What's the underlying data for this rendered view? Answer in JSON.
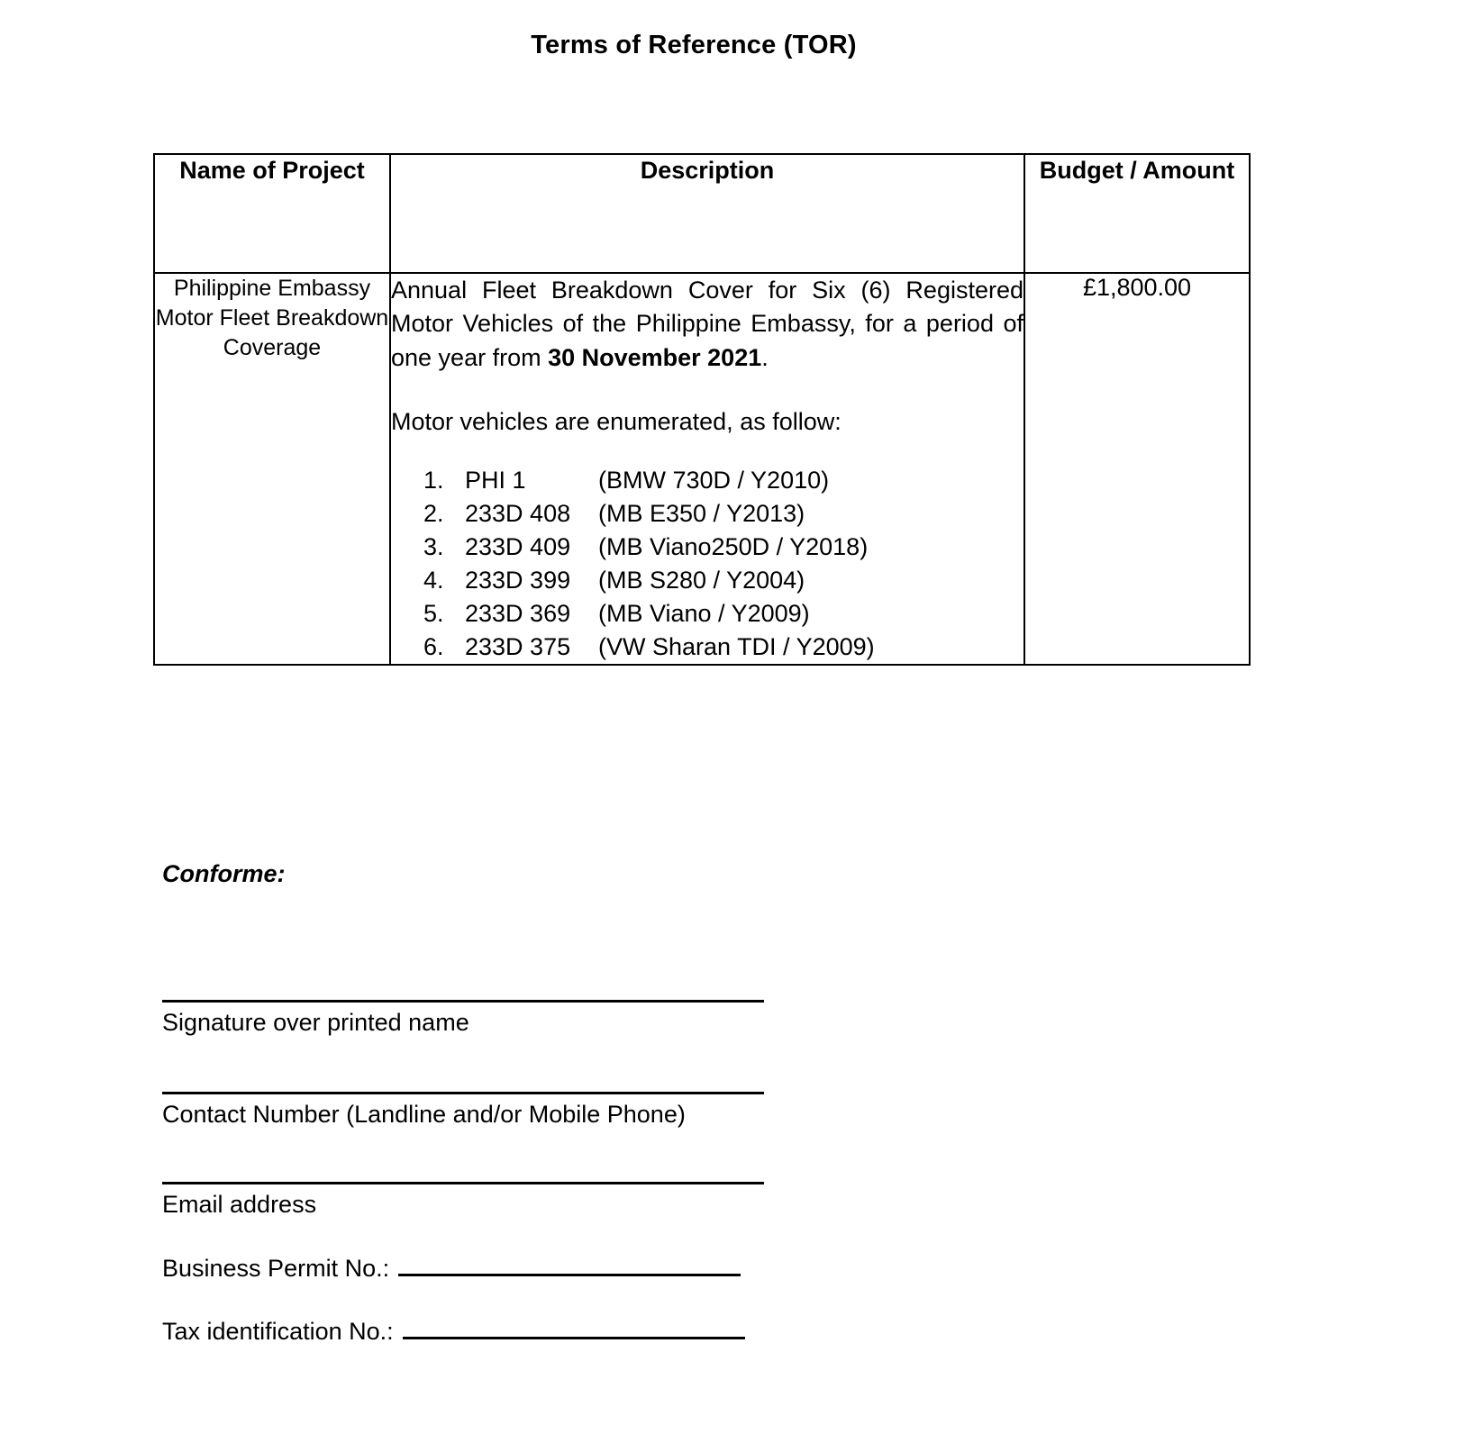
{
  "document": {
    "title": "Terms of Reference (TOR)"
  },
  "table": {
    "headers": {
      "project": "Name of Project",
      "description": "Description",
      "budget": "Budget / Amount"
    },
    "row": {
      "project_name": "Philippine Embassy Motor Fleet Breakdown Coverage",
      "description": {
        "intro_before_bold": "Annual Fleet Breakdown Cover for Six (6) Registered Motor Vehicles of the Philippine Embassy, for a period of one year from ",
        "intro_bold": "30 November 2021",
        "intro_after_bold": ".",
        "list_intro": "Motor vehicles are enumerated, as follow:",
        "vehicles": [
          {
            "plate": "PHI 1",
            "details": "(BMW 730D / Y2010)"
          },
          {
            "plate": "233D 408",
            "details": "(MB E350 / Y2013)"
          },
          {
            "plate": "233D 409",
            "details": "(MB Viano250D / Y2018)"
          },
          {
            "plate": "233D 399",
            "details": "(MB S280 / Y2004)"
          },
          {
            "plate": "233D 369",
            "details": "(MB Viano / Y2009)"
          },
          {
            "plate": "233D 375",
            "details": "(VW Sharan TDI / Y2009)"
          }
        ]
      },
      "budget_amount": "£1,800.00"
    }
  },
  "conforme": {
    "heading": "Conforme:",
    "signature_label": "Signature over printed name",
    "contact_label": "Contact Number (Landline and/or Mobile Phone)",
    "email_label": "Email address",
    "business_permit_label": "Business Permit No.:",
    "tax_id_label": "Tax identification No.:"
  }
}
